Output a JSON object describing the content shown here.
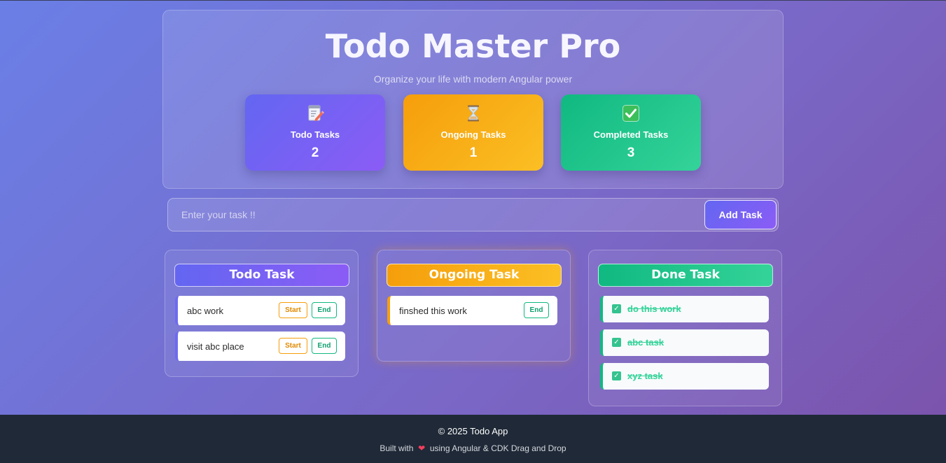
{
  "header": {
    "title": "Todo Master Pro",
    "subtitle": "Organize your life with modern Angular power"
  },
  "stats": [
    {
      "icon": "memo-icon",
      "label": "Todo Tasks",
      "count": "2",
      "color": "#6366f1"
    },
    {
      "icon": "hourglass-icon",
      "label": "Ongoing Tasks",
      "count": "1",
      "color": "#f59e0b"
    },
    {
      "icon": "check-mark-icon",
      "label": "Completed Tasks",
      "count": "3",
      "color": "#10b981"
    }
  ],
  "add_task": {
    "placeholder": "Enter your task !!",
    "value": "",
    "button_label": "Add Task"
  },
  "columns": {
    "todo": {
      "title": "Todo Task",
      "tasks": [
        {
          "text": "abc work",
          "start_label": "Start",
          "end_label": "End"
        },
        {
          "text": "visit abc place",
          "start_label": "Start",
          "end_label": "End"
        }
      ]
    },
    "ongoing": {
      "title": "Ongoing Task",
      "tasks": [
        {
          "text": "finshed this work",
          "end_label": "End"
        }
      ]
    },
    "done": {
      "title": "Done Task",
      "tasks": [
        {
          "text": "do this work"
        },
        {
          "text": "abc task"
        },
        {
          "text": "xyz task"
        }
      ]
    }
  },
  "footer": {
    "copyright": "© 2025 Todo App",
    "built_prefix": "Built with",
    "built_suffix": "using Angular & CDK Drag and Drop"
  }
}
